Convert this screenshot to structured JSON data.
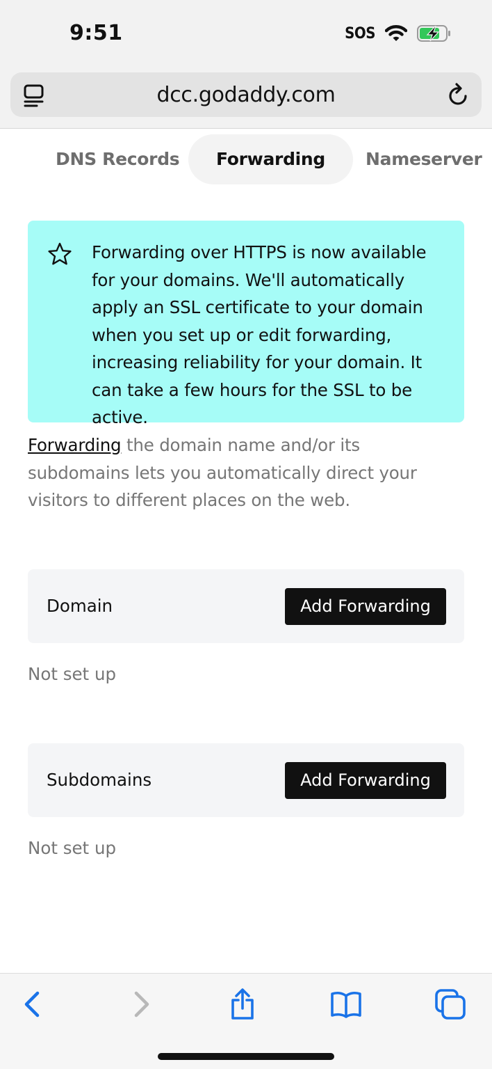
{
  "status": {
    "time": "9:51",
    "carrier": "SOS"
  },
  "browser": {
    "url": "dcc.godaddy.com"
  },
  "tabs": [
    {
      "label": "DNS Records"
    },
    {
      "label": "Forwarding",
      "active": true
    },
    {
      "label": "Nameserver"
    }
  ],
  "banner": {
    "text": "Forwarding over HTTPS is now available for your domains. We'll automatically apply an SSL certificate to your domain when you set up or edit forwarding, increasing reliability for your domain. It can take a few hours for the SSL to be active."
  },
  "description": {
    "link": "Forwarding",
    "text": " the domain name and/or its subdomains lets you automatically direct your visitors to different places on the web."
  },
  "sections": [
    {
      "label": "Domain",
      "button": "Add Forwarding",
      "status": "Not set up"
    },
    {
      "label": "Subdomains",
      "button": "Add Forwarding",
      "status": "Not set up"
    }
  ],
  "colors": {
    "banner": "#a6fcf7",
    "accent": "#1a73e8",
    "button": "#111111"
  }
}
